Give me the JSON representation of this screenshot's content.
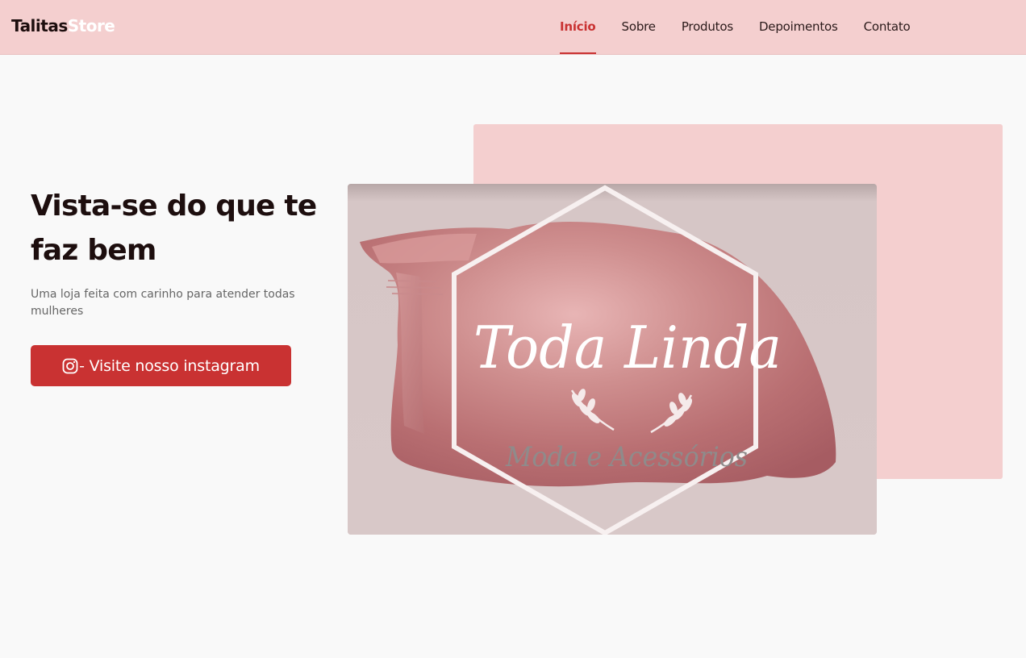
{
  "header": {
    "logo_part1": "Talitas",
    "logo_part2": "Store",
    "nav": [
      "Início",
      "Sobre",
      "Produtos",
      "Depoimentos",
      "Contato"
    ],
    "active_index": 0
  },
  "hero": {
    "title": "Vista-se do que te faz bem",
    "subtitle": "Uma loja feita com carinho para atender todas mulheres",
    "cta_label": "- Visite nosso instagram",
    "cta_icon": "instagram-icon"
  },
  "banner": {
    "brand_name": "Toda Linda",
    "tagline": "Moda e Acessórios"
  },
  "colors": {
    "accent": "#c93232",
    "header_bg": "#f4cfcf",
    "page_bg": "#f9f9f9",
    "title": "#1d0e0e"
  }
}
